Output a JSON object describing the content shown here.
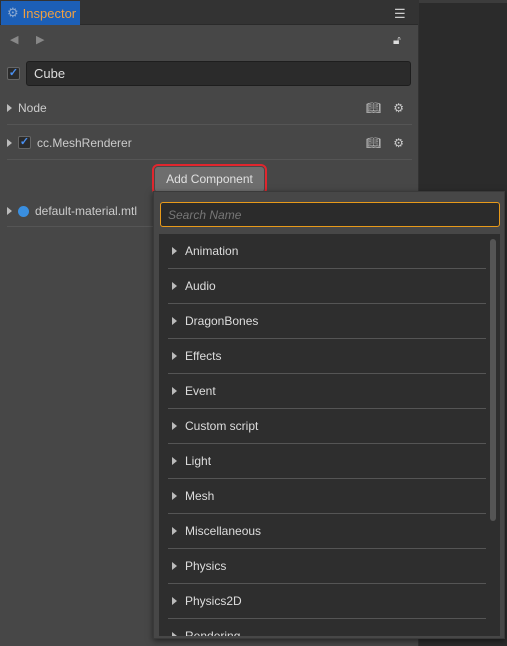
{
  "inspector": {
    "tab_label": "Inspector",
    "node_name": "Cube",
    "node_enabled": true,
    "sections": [
      {
        "label": "Node",
        "has_checkbox": false
      },
      {
        "label": "cc.MeshRenderer",
        "has_checkbox": true,
        "checked": true
      }
    ],
    "add_component_label": "Add Component",
    "material_label": "default-material.mtl"
  },
  "dropdown": {
    "search_placeholder": "Search Name",
    "search_value": "",
    "items": [
      "Animation",
      "Audio",
      "DragonBones",
      "Effects",
      "Event",
      "Custom script",
      "Light",
      "Mesh",
      "Miscellaneous",
      "Physics",
      "Physics2D",
      "Rendering"
    ]
  },
  "colors": {
    "tab_bg": "#1c5fb7",
    "tab_text": "#f0a040",
    "highlight": "#e0262e",
    "search_border": "#e89a1a"
  }
}
